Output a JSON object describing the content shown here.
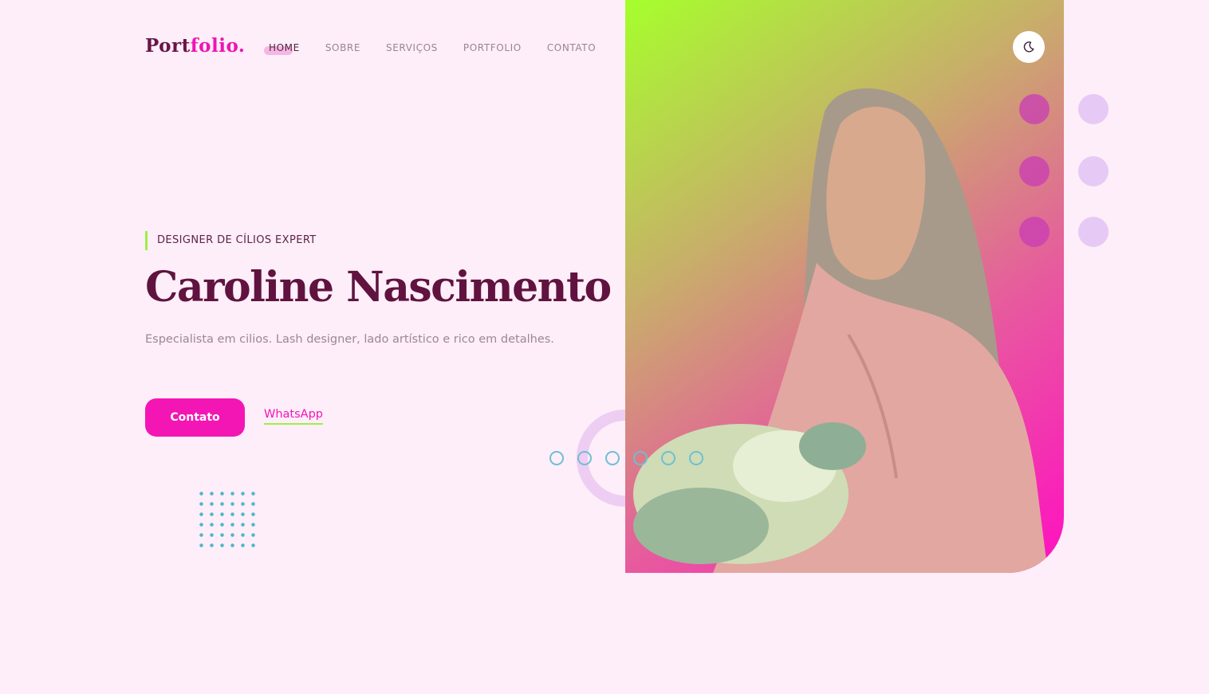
{
  "logo": {
    "main": "Port",
    "accent": "folio."
  },
  "nav": {
    "items": [
      {
        "label": "HOME",
        "active": true
      },
      {
        "label": "SOBRE"
      },
      {
        "label": "SERVIÇOS"
      },
      {
        "label": "PORTFOLIO"
      },
      {
        "label": "CONTATO"
      }
    ]
  },
  "hero": {
    "label": "DESIGNER DE CÍLIOS EXPERT",
    "name": "Caroline Nascimento",
    "description": "Especialista em cilios. Lash designer, lado artístico e rico em detalhes.",
    "contact_button": "Contato",
    "whatsapp_link": "WhatsApp"
  },
  "icons": {
    "theme_toggle": "moon-icon"
  },
  "colors": {
    "accent": "#f316b4",
    "title": "#60133f",
    "highlight": "#9df043",
    "background": "#fdeef9"
  }
}
